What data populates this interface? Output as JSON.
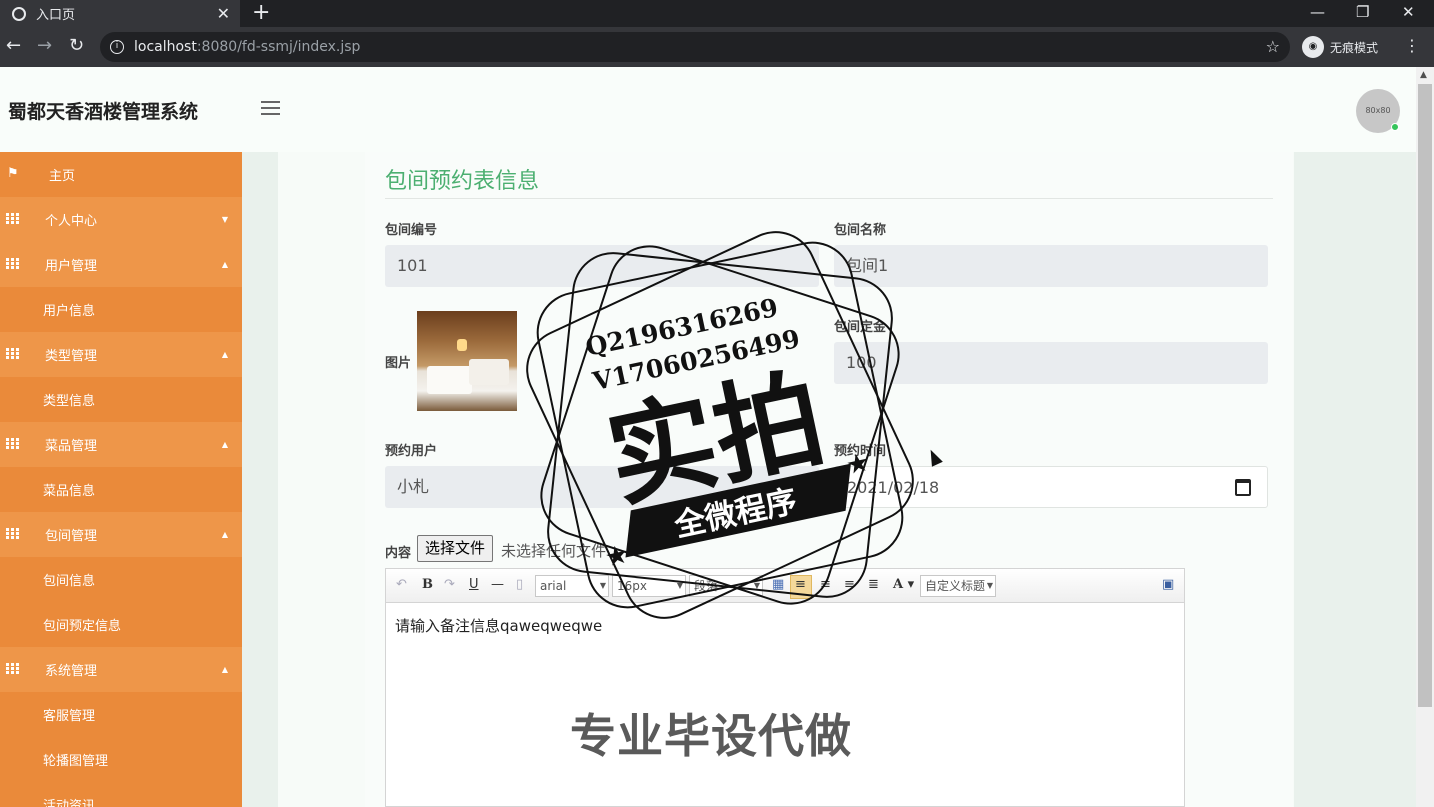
{
  "browser": {
    "tab_title": "入口页",
    "close_glyph": "✕",
    "newtab_glyph": "+",
    "url_host": "localhost",
    "url_path": ":8080/fd-ssmj/index.jsp",
    "incognito_label": "无痕模式",
    "min_glyph": "—",
    "max_glyph": "❐",
    "winclose_glyph": "✕",
    "back_glyph": "←",
    "forward_glyph": "→",
    "reload_glyph": "↻",
    "star_glyph": "☆",
    "kebab_glyph": "⋮"
  },
  "header": {
    "app_title": "蜀都天香酒楼管理系统",
    "avatar_text": "80x80"
  },
  "sidebar": {
    "items": [
      {
        "label": "主页",
        "type": "home",
        "icon": "flag-icon"
      },
      {
        "label": "个人中心",
        "type": "parent",
        "caret": "▼",
        "icon": "grid-icon"
      },
      {
        "label": "用户管理",
        "type": "parent",
        "caret": "▲",
        "icon": "grid-icon"
      },
      {
        "label": "用户信息",
        "type": "child"
      },
      {
        "label": "类型管理",
        "type": "parent",
        "caret": "▲",
        "icon": "grid-icon"
      },
      {
        "label": "类型信息",
        "type": "child"
      },
      {
        "label": "菜品管理",
        "type": "parent",
        "caret": "▲",
        "icon": "grid-icon"
      },
      {
        "label": "菜品信息",
        "type": "child"
      },
      {
        "label": "包间管理",
        "type": "parent",
        "caret": "▲",
        "icon": "grid-icon"
      },
      {
        "label": "包间信息",
        "type": "child"
      },
      {
        "label": "包间预定信息",
        "type": "child"
      },
      {
        "label": "系统管理",
        "type": "parent",
        "caret": "▲",
        "icon": "grid-icon"
      },
      {
        "label": "客服管理",
        "type": "child"
      },
      {
        "label": "轮播图管理",
        "type": "child"
      },
      {
        "label": "活动资讯",
        "type": "child"
      }
    ]
  },
  "form": {
    "title": "包间预约表信息",
    "room_no_label": "包间编号",
    "room_no_value": "101",
    "room_name_label": "包间名称",
    "room_name_value": "包间1",
    "image_label": "图片",
    "deposit_label": "包间定金",
    "deposit_value": "100",
    "user_label": "预约用户",
    "user_value": "小札",
    "time_label": "预约时间",
    "time_value": "2021/02/18",
    "content_label": "内容",
    "file_button": "选择文件",
    "file_none": "未选择任何文件"
  },
  "editor": {
    "font_family": "arial",
    "font_size": "16px",
    "paragraph": "段落",
    "custom_heading": "自定义标题",
    "text": "请输入备注信息qaweqweqwe"
  },
  "watermark": {
    "qq": "Q2196316269",
    "vx": "V17060256499",
    "big": "实拍",
    "banner": "全微程序",
    "bottom": "专业毕设代做"
  },
  "colors": {
    "sidebar": "#ea8a3a",
    "sidebar_parent": "#ee9649",
    "title_green": "#4caf71"
  }
}
